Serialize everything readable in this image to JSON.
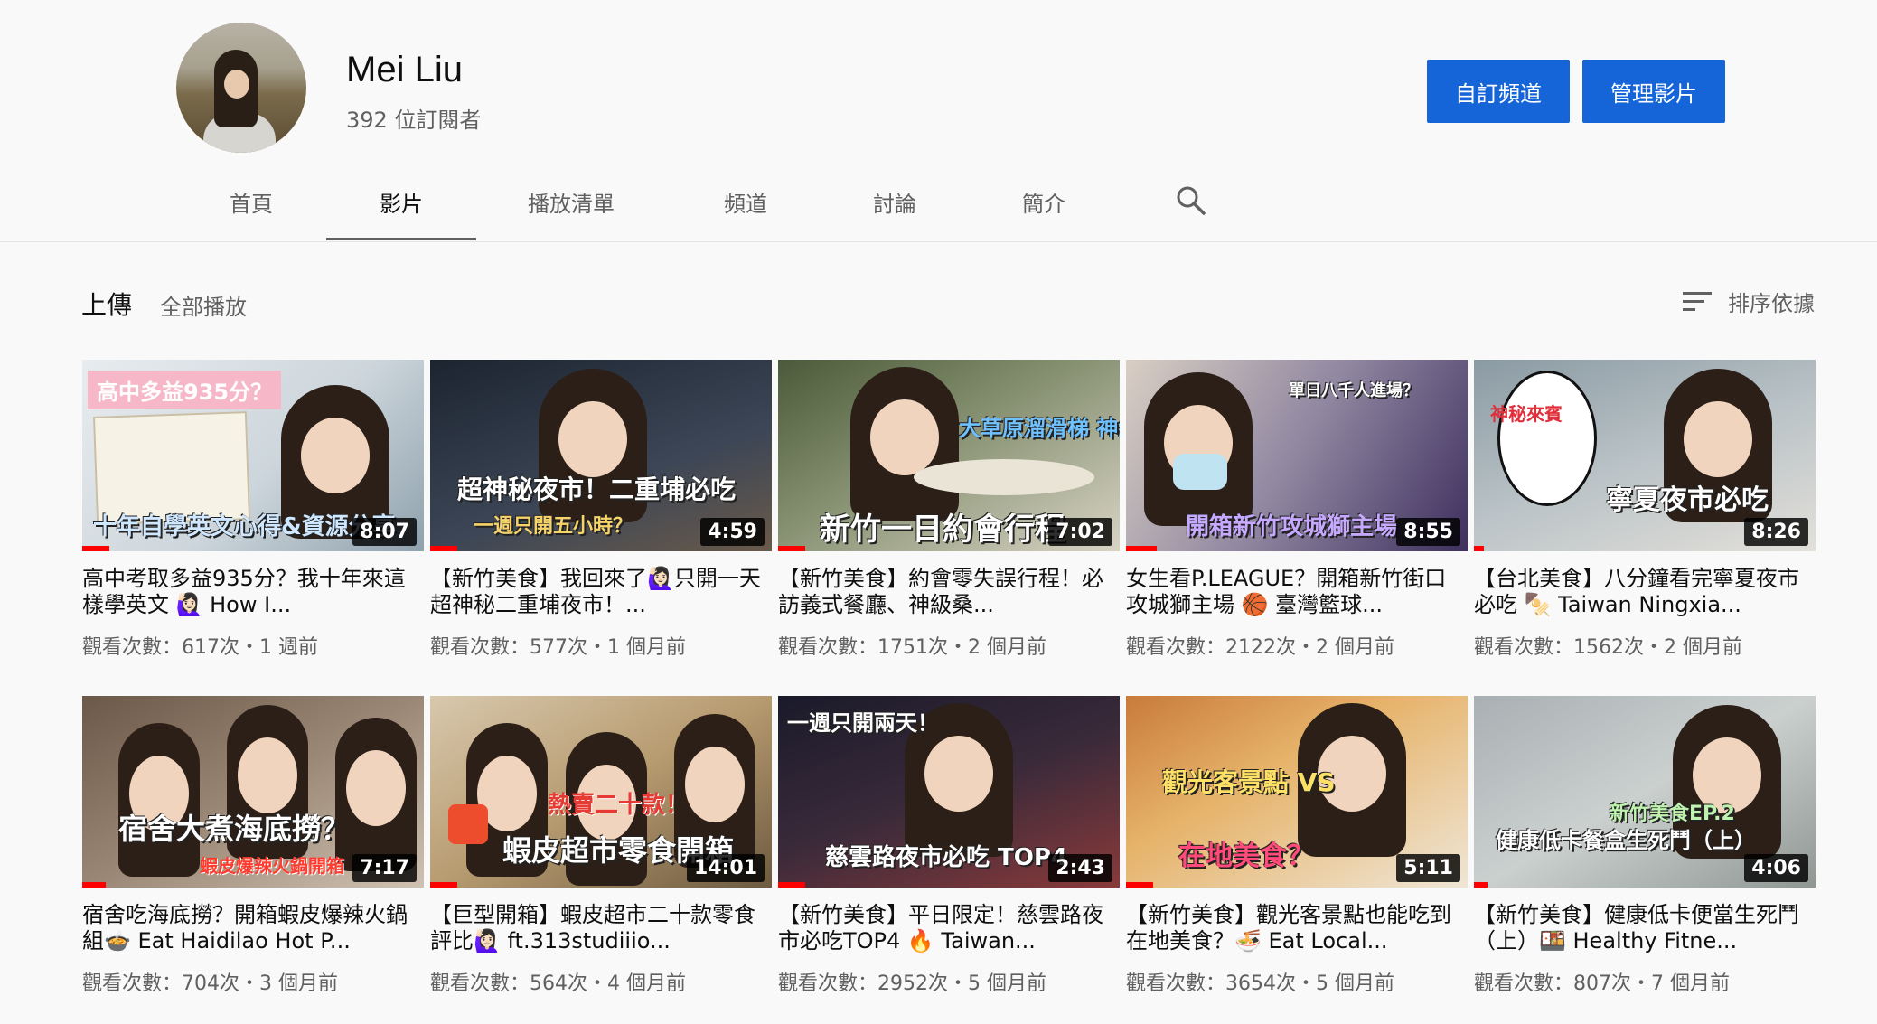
{
  "channel": {
    "name": "Mei Liu",
    "subscribers": "392 位訂閱者",
    "customize_label": "自訂頻道",
    "manage_label": "管理影片"
  },
  "tabs": [
    {
      "label": "首頁"
    },
    {
      "label": "影片"
    },
    {
      "label": "播放清單"
    },
    {
      "label": "頻道"
    },
    {
      "label": "討論"
    },
    {
      "label": "簡介"
    }
  ],
  "active_tab": "影片",
  "section": {
    "title": "上傳",
    "play_all": "全部播放",
    "sort_label": "排序依據"
  },
  "videos": [
    {
      "title": "高中考取多益935分？我十年來這樣學英文 🙋🏻‍♀️ How I...",
      "meta": "觀看次數：617次・1 週前",
      "duration": "8:07",
      "caption": "十年自學英文心得&資源分享",
      "tag": "高中多益935分？",
      "watched": 0.08
    },
    {
      "title": "【新竹美食】我回來了🙋🏻‍♀️只開一天超神秘二重埔夜市！...",
      "meta": "觀看次數：577次・1 個月前",
      "duration": "4:59",
      "caption": "超神秘夜市！二重埔必吃",
      "tag": "一週只開五小時？",
      "watched": 0.08
    },
    {
      "title": "【新竹美食】約會零失誤行程！必訪義式餐廳、神級桑...",
      "meta": "觀看次數：1751次・2 個月前",
      "duration": "7:02",
      "caption": "新竹一日約會行程",
      "tag": "大草原溜滑梯 神級桑椹冰",
      "watched": 0.08
    },
    {
      "title": "女生看P.LEAGUE？開箱新竹街口攻城獅主場 🏀 臺灣籃球...",
      "meta": "觀看次數：2122次・2 個月前",
      "duration": "8:55",
      "caption": "開箱新竹攻城獅主場",
      "tag": "單日八千人進場？",
      "watched": 0.09
    },
    {
      "title": "【台北美食】八分鐘看完寧夏夜市必吃 🍢 Taiwan Ningxia...",
      "meta": "觀看次數：1562次・2 個月前",
      "duration": "8:26",
      "caption": "寧夏夜市必吃",
      "tag": "神秘來賓",
      "watched": 0.03
    },
    {
      "title": "宿舍吃海底撈？開箱蝦皮爆辣火鍋組🍲 Eat Haidilao Hot P...",
      "meta": "觀看次數：704次・3 個月前",
      "duration": "7:17",
      "caption": "宿舍大煮海底撈？",
      "tag": "蝦皮爆辣火鍋開箱",
      "watched": 0.07
    },
    {
      "title": "【巨型開箱】蝦皮超市二十款零食評比🙋🏻‍♀️ ft.313studiiio...",
      "meta": "觀看次數：564次・4 個月前",
      "duration": "14:01",
      "caption": "蝦皮超市零食開箱",
      "tag": "熱賣二十款！",
      "watched": 0.08
    },
    {
      "title": "【新竹美食】平日限定！慈雲路夜市必吃TOP4 🔥 Taiwan...",
      "meta": "觀看次數：2952次・5 個月前",
      "duration": "2:43",
      "caption": "慈雲路夜市必吃 TOP4",
      "tag": "一週只開兩天！",
      "watched": 0.08
    },
    {
      "title": "【新竹美食】觀光客景點也能吃到在地美食？🍜 Eat Local...",
      "meta": "觀看次數：3654次・5 個月前",
      "duration": "5:11",
      "caption": "在地美食？",
      "tag": "觀光客景點 VS",
      "watched": 0.08
    },
    {
      "title": "【新竹美食】健康低卡便當生死鬥（上）🍱 Healthy Fitne...",
      "meta": "觀看次數：807次・7 個月前",
      "duration": "4:06",
      "caption": "健康低卡餐盒生死鬥（上）",
      "tag": "新竹美食EP.2",
      "watched": 0.04
    }
  ],
  "colors": {
    "accent": "#1565d8",
    "progress": "#ff0000"
  },
  "icons": {
    "search": "search-icon",
    "sort": "sort-icon"
  }
}
